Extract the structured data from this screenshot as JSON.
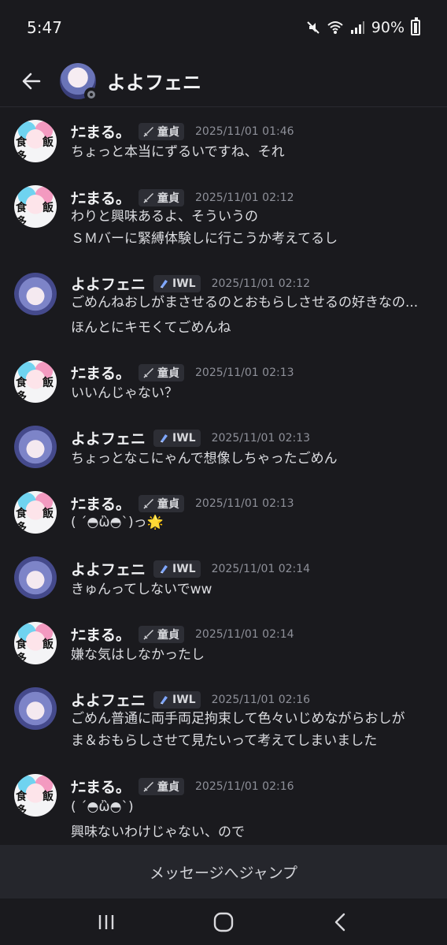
{
  "status_bar": {
    "time": "5:47",
    "battery": "90%"
  },
  "header": {
    "title": "よよフェニ"
  },
  "users": {
    "nako": {
      "name": "ﾅﾆまる。",
      "tag": "童貞",
      "avatar_text": [
        "食",
        "飯",
        "多"
      ]
    },
    "yoyo": {
      "name": "よよフェニ",
      "tag": "IWL"
    }
  },
  "messages": [
    {
      "user": "ﾅﾆまる。",
      "tag": "童貞",
      "time": "2025/11/01 01:46",
      "lines": [
        "ちょっと本当にずるいですね、それ"
      ]
    },
    {
      "user": "ﾅﾆまる。",
      "tag": "童貞",
      "time": "2025/11/01 02:12",
      "lines": [
        "わりと興味あるよ、そういうの",
        "ＳＭバーに緊縛体験しに行こうか考えてるし"
      ]
    },
    {
      "user": "よよフェニ",
      "tag": "IWL",
      "time": "2025/11/01 02:12",
      "lines": [
        "ごめんねおしがまさせるのとおもらしさせるの好きなの...",
        "ほんとにキモくてごめんね"
      ]
    },
    {
      "user": "ﾅﾆまる。",
      "tag": "童貞",
      "time": "2025/11/01 02:13",
      "lines": [
        "いいんじゃない？"
      ]
    },
    {
      "user": "よよフェニ",
      "tag": "IWL",
      "time": "2025/11/01 02:13",
      "lines": [
        "ちょっとなこにゃんで想像しちゃったごめん"
      ]
    },
    {
      "user": "ﾅﾆまる。",
      "tag": "童貞",
      "time": "2025/11/01 02:13",
      "lines": [
        "( ´◓ὢ◓`)っ🌟"
      ]
    },
    {
      "user": "よよフェニ",
      "tag": "IWL",
      "time": "2025/11/01 02:14",
      "lines": [
        "きゅんってしないでww"
      ]
    },
    {
      "user": "ﾅﾆまる。",
      "tag": "童貞",
      "time": "2025/11/01 02:14",
      "lines": [
        "嫌な気はしなかったし"
      ]
    },
    {
      "user": "よよフェニ",
      "tag": "IWL",
      "time": "2025/11/01 02:16",
      "lines": [
        "ごめん普通に両手両足拘束して色々いじめながらおしが",
        "ま＆おもらしさせて見たいって考えてしまいました"
      ]
    },
    {
      "user": "ﾅﾆまる。",
      "tag": "童貞",
      "time": "2025/11/01 02:16",
      "lines": [
        "( ´◓ὢ◓`)",
        "興味ないわけじゃない、ので"
      ]
    }
  ],
  "jump_bar": {
    "label": "メッセージへジャンプ"
  },
  "colors": {
    "background": "#1a1a1e",
    "tag_bg": "#2d2e35",
    "timestamp": "#8e9099",
    "jump_bar": "#25262c"
  },
  "icons": [
    "back-arrow-icon",
    "mute-icon",
    "wifi-icon",
    "signal-icon",
    "battery-icon",
    "sword-icon",
    "crystal-icon",
    "recent-apps-icon",
    "home-icon",
    "back-icon"
  ]
}
